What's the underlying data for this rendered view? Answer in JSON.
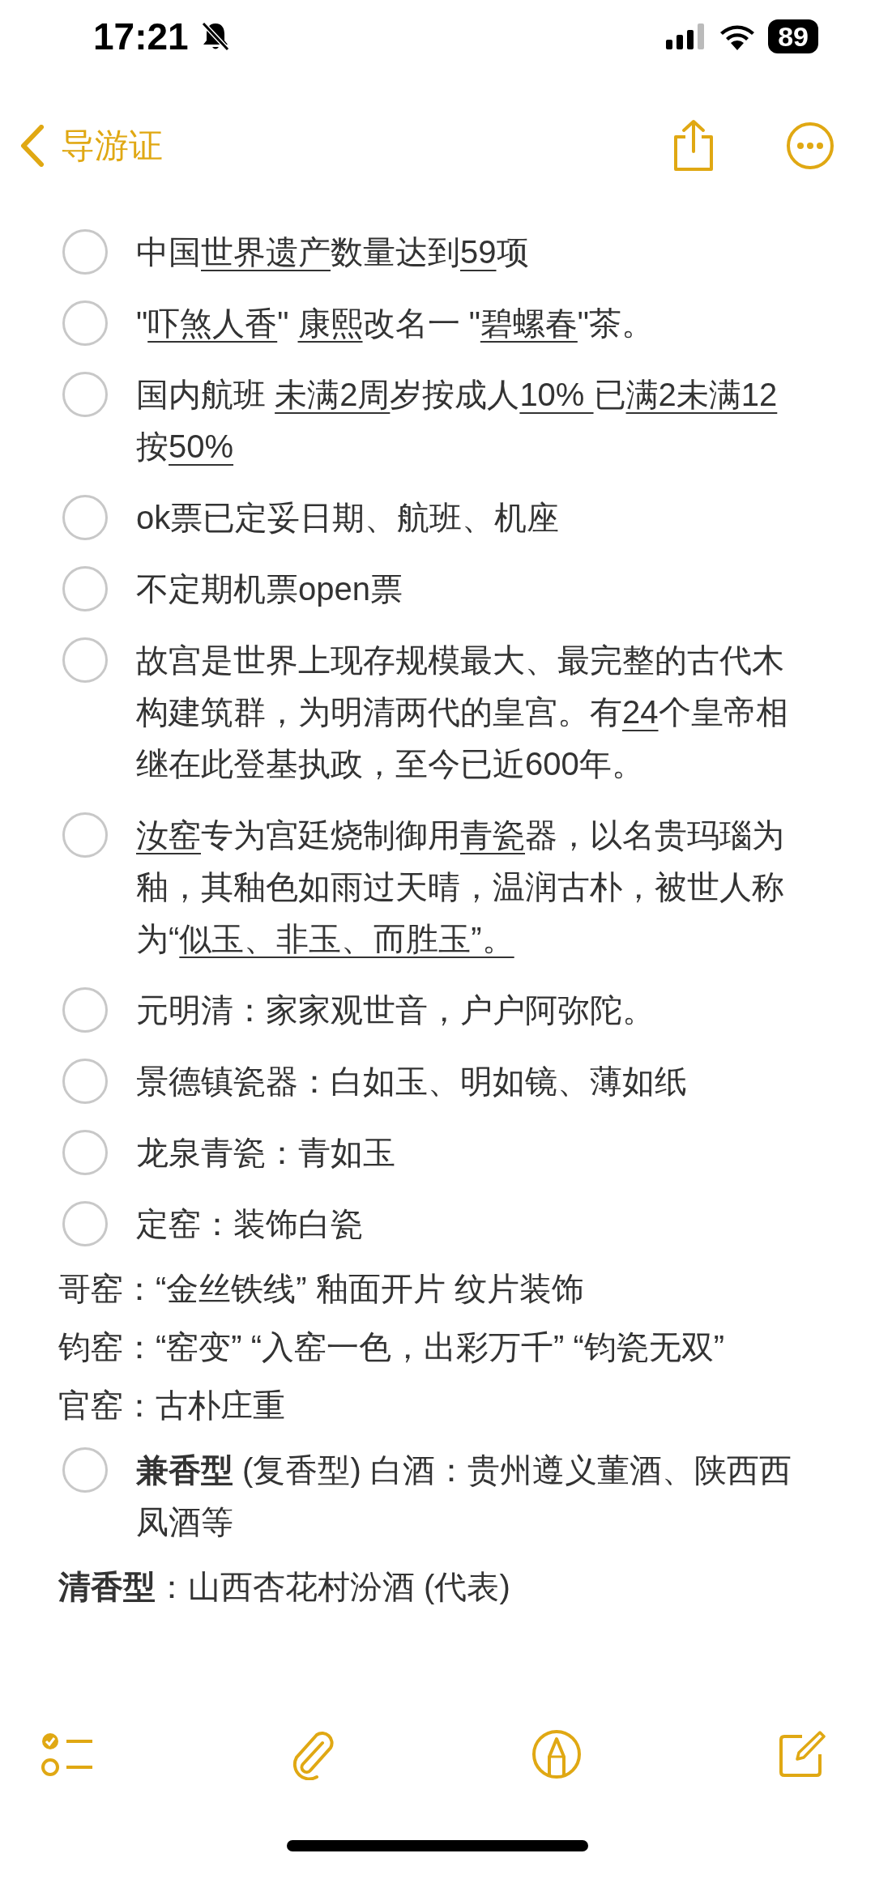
{
  "status_bar": {
    "time": "17:21",
    "battery": "89"
  },
  "nav": {
    "back_label": "导游证"
  },
  "items": [
    {
      "kind": "checklist",
      "checked": false,
      "segments": [
        {
          "text": "中国",
          "underlined": false
        },
        {
          "text": "世界遗产",
          "underlined": true
        },
        {
          "text": "数量达到",
          "underlined": false
        },
        {
          "text": "59",
          "underlined": true
        },
        {
          "text": "项",
          "underlined": false
        }
      ]
    },
    {
      "kind": "checklist",
      "checked": false,
      "segments": [
        {
          "text": "\"",
          "underlined": false
        },
        {
          "text": "吓煞人香",
          "underlined": true
        },
        {
          "text": "\" ",
          "underlined": false
        },
        {
          "text": "康熙",
          "underlined": true
        },
        {
          "text": "改名一 \"",
          "underlined": false
        },
        {
          "text": "碧螺春",
          "underlined": true
        },
        {
          "text": "\"茶。",
          "underlined": false
        }
      ]
    },
    {
      "kind": "checklist",
      "checked": false,
      "segments": [
        {
          "text": "国内航班 ",
          "underlined": false
        },
        {
          "text": "未满2周",
          "underlined": true
        },
        {
          "text": "岁按成人",
          "underlined": false
        },
        {
          "text": "10% ",
          "underlined": true
        },
        {
          "text": " 已",
          "underlined": false
        },
        {
          "text": "满2未满12",
          "underlined": true
        },
        {
          "text": "按",
          "underlined": false
        },
        {
          "text": "50%",
          "underlined": true
        }
      ]
    },
    {
      "kind": "checklist",
      "checked": false,
      "segments": [
        {
          "text": "ok票已定妥日期、航班、机座",
          "underlined": false
        }
      ]
    },
    {
      "kind": "checklist",
      "checked": false,
      "segments": [
        {
          "text": "不定期机票open票",
          "underlined": false
        }
      ]
    },
    {
      "kind": "checklist",
      "checked": false,
      "segments": [
        {
          "text": "故宫是世界上现存规模最大、最完整的古代木构建筑群，为明清两代的皇宫。有",
          "underlined": false
        },
        {
          "text": "24",
          "underlined": true
        },
        {
          "text": "个皇帝相继在此登基执政，至今已近600年。",
          "underlined": false
        }
      ]
    },
    {
      "kind": "checklist",
      "checked": false,
      "segments": [
        {
          "text": "汝窑",
          "underlined": true
        },
        {
          "text": "专为宫廷烧制御用",
          "underlined": false
        },
        {
          "text": "青瓷",
          "underlined": true
        },
        {
          "text": "器，以名贵玛瑙为釉，其釉色如雨过天晴，温润古朴，被世人称为“",
          "underlined": false
        },
        {
          "text": "似玉、非玉、而胜玉”。",
          "underlined": true
        }
      ]
    },
    {
      "kind": "checklist",
      "checked": false,
      "segments": [
        {
          "text": "元明清：家家观世音，户户阿弥陀。",
          "underlined": false
        }
      ]
    },
    {
      "kind": "checklist",
      "checked": false,
      "segments": [
        {
          "text": "景德镇瓷器：白如玉、明如镜、薄如纸",
          "underlined": false
        }
      ]
    },
    {
      "kind": "checklist",
      "checked": false,
      "segments": [
        {
          "text": "龙泉青瓷：青如玉",
          "underlined": false
        }
      ]
    },
    {
      "kind": "checklist",
      "checked": false,
      "segments": [
        {
          "text": "定窑：装饰白瓷",
          "underlined": false
        }
      ]
    },
    {
      "kind": "text",
      "segments": [
        {
          "text": "哥窑：“金丝铁线” 釉面开片  纹片装饰",
          "underlined": false
        }
      ]
    },
    {
      "kind": "text",
      "segments": [
        {
          "text": "钧窑：“窑变” “入窑一色，出彩万千” “钧瓷无双”",
          "underlined": false
        }
      ]
    },
    {
      "kind": "text",
      "segments": [
        {
          "text": "官窑：古朴庄重",
          "underlined": false
        }
      ]
    },
    {
      "kind": "checklist",
      "checked": false,
      "segments": [
        {
          "text": "**兼香型** (复香型) 白酒：贵州遵义董酒、陕西西凤酒等",
          "underlined": false
        }
      ]
    },
    {
      "kind": "text",
      "segments": [
        {
          "text": "**清香型**：山西杏花村汾酒 (代表)",
          "underlined": false
        }
      ]
    }
  ]
}
